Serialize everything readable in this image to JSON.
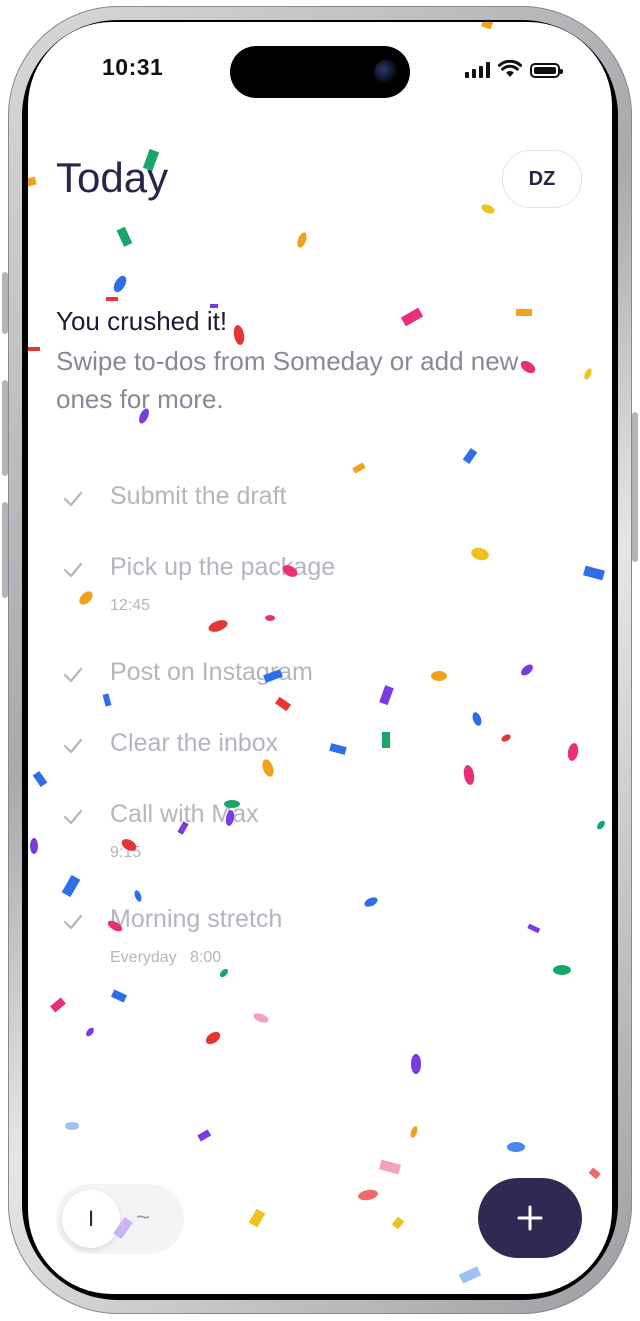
{
  "status": {
    "time": "10:31"
  },
  "header": {
    "title": "Today",
    "avatar_initials": "DZ"
  },
  "empty_state": {
    "title": "You crushed it!",
    "subtitle": "Swipe to-dos from Someday or add new ones for more."
  },
  "todos": [
    {
      "label": "Submit the draft",
      "meta": ""
    },
    {
      "label": "Pick up the package",
      "meta": "12:45"
    },
    {
      "label": "Post on Instagram",
      "meta": ""
    },
    {
      "label": "Clear the inbox",
      "meta": ""
    },
    {
      "label": "Call with Max",
      "meta": "9:15"
    },
    {
      "label": "Morning stretch",
      "meta": "Everyday   8:00"
    }
  ],
  "bottom_bar": {
    "mode_active": "I",
    "mode_alt": "~"
  },
  "icons": {
    "check": "checkmark-icon",
    "add": "plus-icon",
    "signal": "signal-icon",
    "wifi": "wifi-icon",
    "battery": "battery-icon"
  },
  "colors": {
    "title": "#2b2448",
    "muted_text": "#8a8796",
    "completed_text": "#b6b4bf",
    "fab": "#2f2a52"
  }
}
